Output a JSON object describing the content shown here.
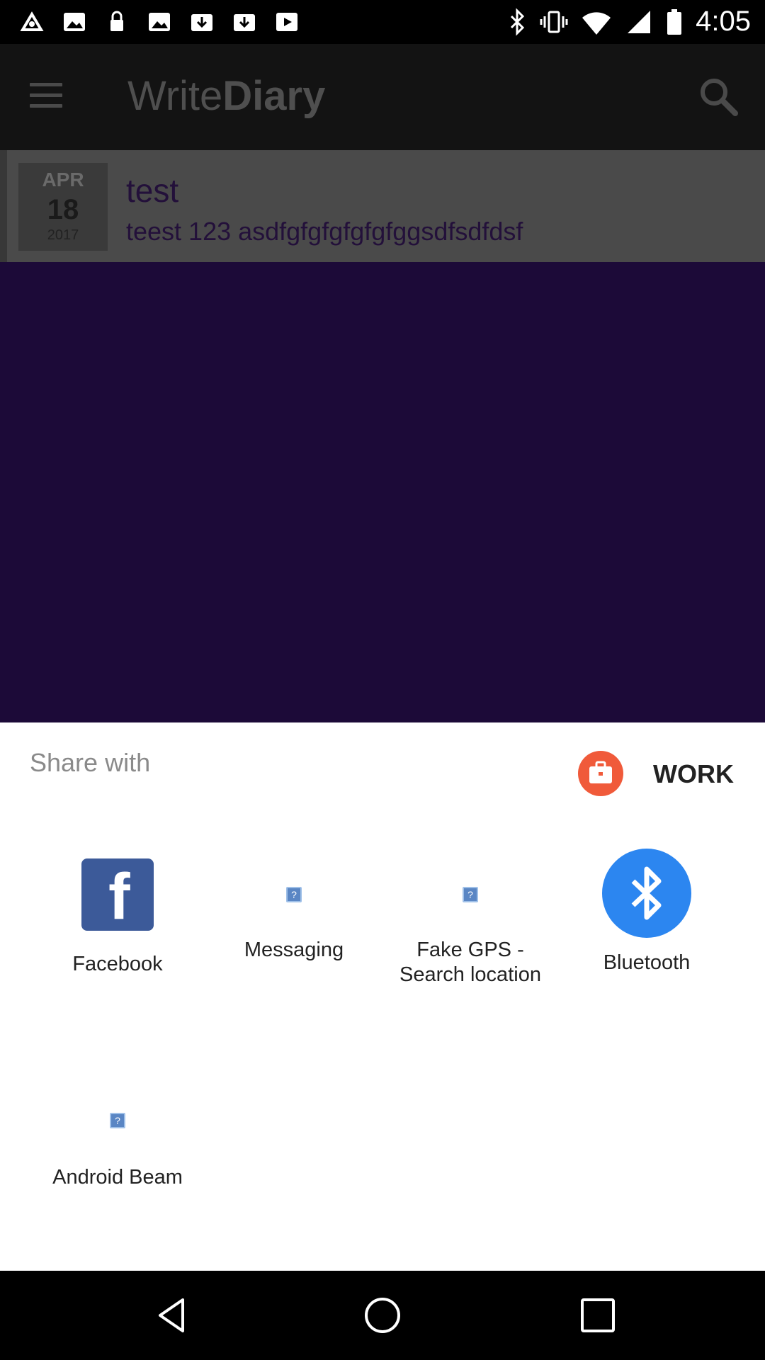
{
  "status_bar": {
    "time": "4:05",
    "left_icons": [
      "fake-gps-icon",
      "gallery-icon",
      "lock-icon",
      "gallery-icon",
      "download-icon",
      "download-icon",
      "video-icon"
    ],
    "right_icons": [
      "bluetooth-icon",
      "vibrate-icon",
      "wifi-icon",
      "cellular-signal-icon",
      "battery-icon"
    ]
  },
  "app_bar": {
    "title_part1": "Write",
    "title_part2": "Diary",
    "menu_icon": "menu-icon",
    "search_icon": "search-icon"
  },
  "entry": {
    "month": "APR",
    "day": "18",
    "year": "2017",
    "title": "test",
    "body": "teest 123 asdfgfgfgfgfgfggsdfsdfdsf"
  },
  "share_sheet": {
    "title": "Share with",
    "work_label": "WORK",
    "work_icon": "briefcase-icon",
    "targets": [
      {
        "label": "Facebook",
        "icon": "facebook-icon"
      },
      {
        "label": "Messaging",
        "icon": "unknown-app-icon"
      },
      {
        "label": "Fake GPS - Search location",
        "icon": "unknown-app-icon"
      },
      {
        "label": "Bluetooth",
        "icon": "bluetooth-icon"
      },
      {
        "label": "Android Beam",
        "icon": "unknown-app-icon"
      }
    ]
  },
  "nav_bar": {
    "back_icon": "back-icon",
    "home_icon": "home-icon",
    "recents_icon": "recents-icon"
  },
  "colors": {
    "facebook": "#3c5a99",
    "bluetooth": "#2c86f0",
    "work": "#f05a3a",
    "dimmed_content": "#1c0a38"
  }
}
